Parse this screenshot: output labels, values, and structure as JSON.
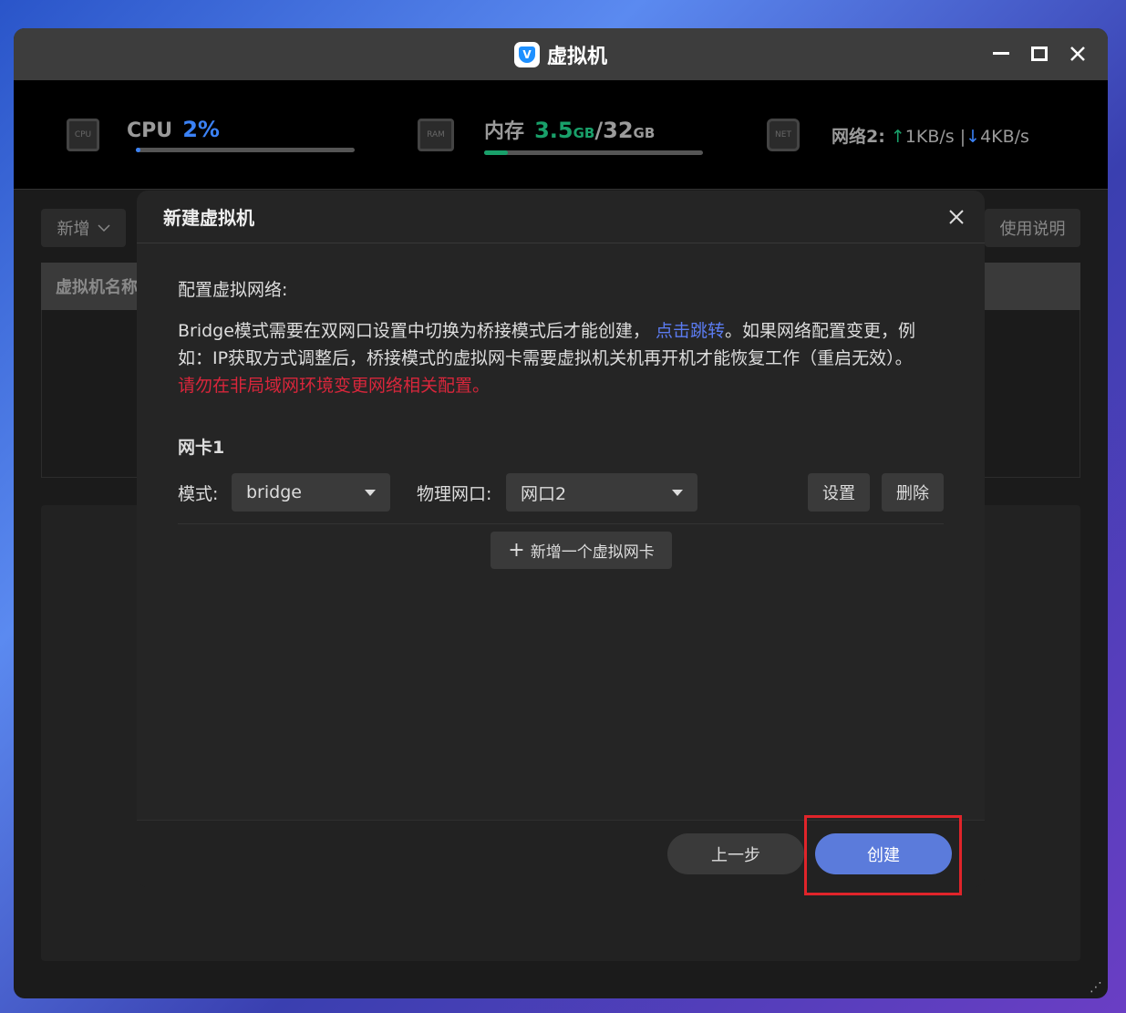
{
  "window": {
    "title": "虚拟机",
    "icon_letter": "V",
    "controls": [
      "minimize-icon",
      "maximize-icon",
      "close-icon"
    ]
  },
  "stats": {
    "cpu": {
      "chip_label": "CPU",
      "label": "CPU",
      "value": "2%",
      "usage": 0.02,
      "value_color": "#3b82f6"
    },
    "ram": {
      "chip_label": "RAM",
      "label": "内存",
      "used": "3.5",
      "used_unit": "GB",
      "sep": "/",
      "total": "32",
      "total_unit": "GB",
      "usage": 0.11,
      "value_color": "#19a06a"
    },
    "net": {
      "chip_label": "NET",
      "label": "网络2:",
      "up_arrow": "↑",
      "up": "1KB/s",
      "divider": "|",
      "down_arrow": "↓",
      "down": "4KB/s"
    }
  },
  "toolbar": {
    "new_label": "新增",
    "help_label": "使用说明"
  },
  "table": {
    "header_name": "虚拟机名称"
  },
  "modal": {
    "title": "新建虚拟机",
    "section_title": "配置虚拟网络:",
    "desc_part1": "Bridge模式需要在双网口设置中切换为桥接模式后才能创建，",
    "desc_link": "点击跳转",
    "desc_part2": "。如果网络配置变更，例",
    "desc_line2": "如：IP获取方式调整后，桥接模式的虚拟网卡需要虚拟机关机再开机才能恢复工作（重启无效）。",
    "warning": "请勿在非局域网环境变更网络相关配置。",
    "nic": {
      "title": "网卡1",
      "mode_label": "模式:",
      "mode_value": "bridge",
      "port_label": "物理网口:",
      "port_value": "网口2",
      "settings_button": "设置",
      "delete_button": "删除"
    },
    "add_nic_plus": "+",
    "add_nic_label": "新增一个虚拟网卡",
    "prev_button": "上一步",
    "create_button": "创建",
    "accent_color": "#5b7bdb"
  }
}
